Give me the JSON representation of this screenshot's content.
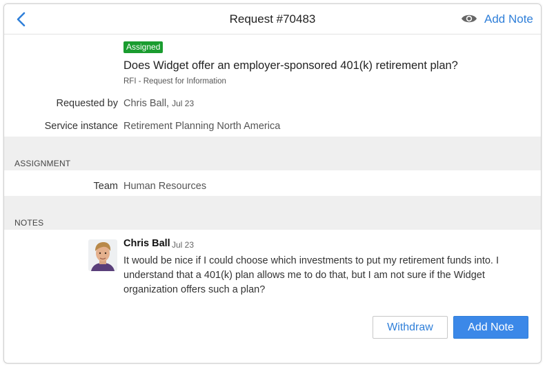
{
  "header": {
    "title": "Request #70483",
    "add_note_label": "Add Note"
  },
  "request": {
    "status_badge": "Assigned",
    "subject": "Does Widget offer an employer-sponsored 401(k) retirement plan?",
    "type": "RFI - Request for Information",
    "requested_by_label": "Requested by",
    "requested_by_name": "Chris Ball",
    "requested_by_date": "Jul 23",
    "service_instance_label": "Service instance",
    "service_instance_value": "Retirement Planning North America"
  },
  "assignment": {
    "section_title": "ASSIGNMENT",
    "team_label": "Team",
    "team_value": "Human Resources"
  },
  "notes": {
    "section_title": "NOTES",
    "items": [
      {
        "author": "Chris Ball",
        "date": "Jul 23",
        "text": "It would be nice if I could choose which investments to put my retirement funds into. I understand that a 401(k) plan allows me to do that, but I am not sure if the Widget organization offers such a plan?"
      }
    ]
  },
  "actions": {
    "withdraw_label": "Withdraw",
    "add_note_label": "Add Note"
  },
  "colors": {
    "accent": "#2f7fd9",
    "primary_button": "#3b88e8",
    "badge_green": "#1a9c2f",
    "section_band": "#efefef"
  },
  "icons": {
    "back": "chevron-left-icon",
    "watch": "eye-icon"
  }
}
